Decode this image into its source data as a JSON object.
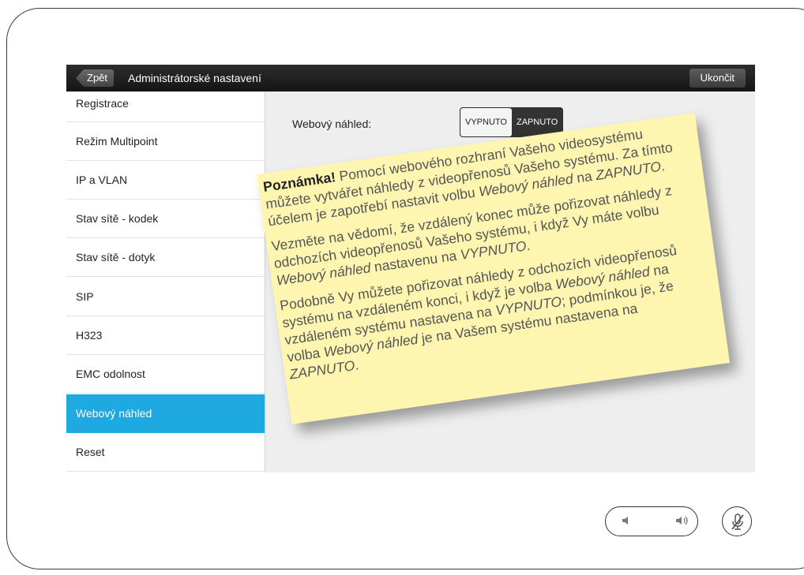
{
  "topbar": {
    "back_label": "Zpět",
    "title": "Administrátorské nastavení",
    "exit_label": "Ukončit"
  },
  "sidebar": {
    "items": [
      {
        "label": "Registrace"
      },
      {
        "label": "Režim Multipoint"
      },
      {
        "label": "IP a VLAN"
      },
      {
        "label": "Stav sítě - kodek"
      },
      {
        "label": "Stav sítě - dotyk"
      },
      {
        "label": "SIP"
      },
      {
        "label": "H323"
      },
      {
        "label": "EMC odolnost"
      },
      {
        "label": "Webový náhled",
        "active": true
      },
      {
        "label": "Reset"
      }
    ]
  },
  "setting": {
    "label": "Webový náhled:",
    "off_label": "VYPNUTO",
    "on_label": "ZAPNUTO"
  },
  "note": {
    "p1_strong": "Poznámka!",
    "p1_a": " Pomocí webového rozhraní Vašeho videosystému můžete vytvářet náhledy z videopřenosů Vašeho systému. Za tímto účelem je zapotřebí nastavit volbu ",
    "p1_em1": "Webový náhled",
    "p1_b": " na ",
    "p1_em2": "ZAPNUTO",
    "p1_c": ".",
    "p2_a": "Vezměte na vědomí, že vzdálený konec může pořizovat náhledy z odchozích videopřenosů Vašeho systému, i když Vy máte volbu ",
    "p2_em1": "Webový náhled",
    "p2_b": " nastavenu na ",
    "p2_em2": "VYPNUTO",
    "p2_c": ".",
    "p3_a": "Podobně Vy můžete pořizovat náhledy z odchozích videopřenosů systému na vzdáleném konci, i když je volba ",
    "p3_em1": "Webový náhled",
    "p3_b": " na vzdáleném systému nastavena na ",
    "p3_em2": "VYPNUTO",
    "p3_c": "; podmínkou je, že volba ",
    "p3_em3": "Webový náhled",
    "p3_d": " je na Vašem systému nastavena na ",
    "p3_em4": "ZAPNUTO",
    "p3_e": "."
  },
  "controls": {
    "volume_down_icon": "speaker-low-icon",
    "volume_up_icon": "speaker-high-icon",
    "mute_icon": "microphone-muted-icon"
  }
}
